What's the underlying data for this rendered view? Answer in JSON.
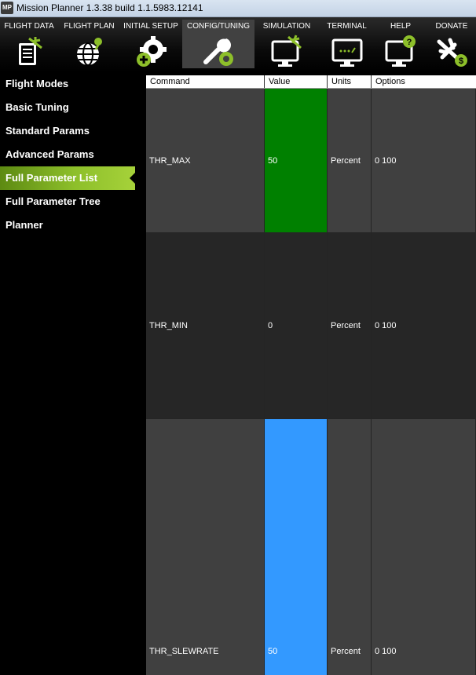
{
  "window": {
    "logo_text": "MP",
    "title": "Mission Planner 1.3.38 build 1.1.5983.12141"
  },
  "toolbar": {
    "items": [
      {
        "label": "FLIGHT DATA",
        "icon": "flight-data-icon"
      },
      {
        "label": "FLIGHT PLAN",
        "icon": "flight-plan-icon"
      },
      {
        "label": "INITIAL SETUP",
        "icon": "initial-setup-icon"
      },
      {
        "label": "CONFIG/TUNING",
        "icon": "config-tuning-icon",
        "active": true
      },
      {
        "label": "SIMULATION",
        "icon": "simulation-icon"
      },
      {
        "label": "TERMINAL",
        "icon": "terminal-icon"
      },
      {
        "label": "HELP",
        "icon": "help-icon"
      },
      {
        "label": "DONATE",
        "icon": "donate-icon"
      }
    ]
  },
  "sidebar": {
    "items": [
      {
        "label": "Flight Modes"
      },
      {
        "label": "Basic Tuning"
      },
      {
        "label": "Standard Params"
      },
      {
        "label": "Advanced Params"
      },
      {
        "label": "Full Parameter List",
        "active": true
      },
      {
        "label": "Full Parameter Tree"
      },
      {
        "label": "Planner"
      }
    ]
  },
  "grid": {
    "columns": [
      "Command",
      "Value",
      "Units",
      "Options"
    ],
    "rows": [
      {
        "command": "THR_MAX",
        "value": "50",
        "units": "Percent",
        "options": "0 100",
        "value_color": "#008000"
      },
      {
        "command": "THR_MIN",
        "value": "0",
        "units": "Percent",
        "options": "0 100",
        "value_color": null
      },
      {
        "command": "THR_SLEWRATE",
        "value": "50",
        "units": "Percent",
        "options": "0 100",
        "value_color": "#3399ff"
      }
    ]
  },
  "colors": {
    "accent_green": "#8dbf2a",
    "toolbar_bg": "#000000",
    "active_tab_bg": "#414141"
  }
}
